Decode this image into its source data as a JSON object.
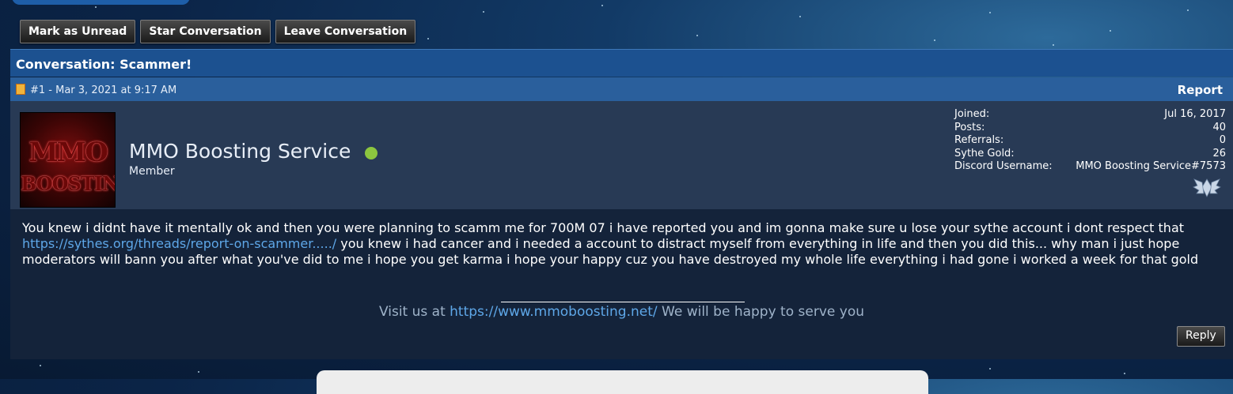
{
  "actions": {
    "mark_unread": "Mark as Unread",
    "star": "Star Conversation",
    "leave": "Leave Conversation"
  },
  "conversation": {
    "title": "Conversation: Scammer!"
  },
  "post": {
    "header": "#1 - Mar 3, 2021 at 9:17 AM",
    "report_label": "Report",
    "author": {
      "name": "MMO Boosting Service",
      "title": "Member",
      "avatar_text_top": "MMO",
      "avatar_text_bottom": "BOOSTING",
      "online_color": "#8cc63f"
    },
    "stats": [
      {
        "label": "Joined:",
        "value": "Jul 16, 2017"
      },
      {
        "label": "Posts:",
        "value": "40"
      },
      {
        "label": "Referrals:",
        "value": "0"
      },
      {
        "label": "Sythe Gold:",
        "value": "26"
      },
      {
        "label": "Discord Username:",
        "value": "MMO Boosting Service#7573"
      }
    ],
    "badge_icon": "wings-badge-icon",
    "message": {
      "part1": "You knew i didnt have it mentally ok and then you were planning to scamm me for 700M 07 i have reported you and im gonna make sure u lose your sythe account i dont respect that ",
      "link": "https://sythes.org/threads/report-on-scammer...../",
      "part2": " you knew i had cancer and i needed a account to distract myself from everything in life and then you did this... why man i just hope moderators will bann you after what you've did to me i hope you get karma i hope your happy cuz you have destroyed my whole life everything i had gone i worked a week for that gold"
    },
    "signature": {
      "prefix": "Visit us at ",
      "link": "https://www.mmoboosting.net/",
      "suffix": " We will be happy to serve you"
    },
    "reply_label": "Reply"
  }
}
